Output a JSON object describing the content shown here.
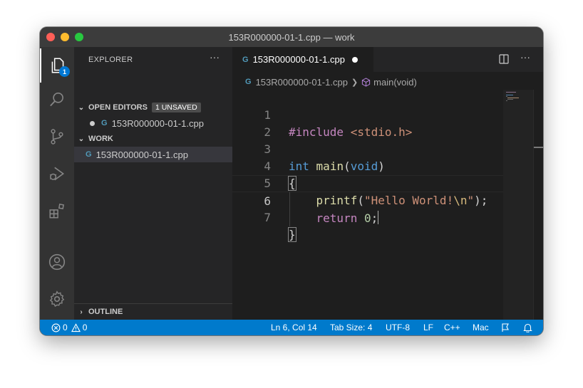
{
  "window": {
    "title": "153R000000-01-1.cpp — work"
  },
  "activity_bar": {
    "explorer_badge": "1"
  },
  "sidebar": {
    "header": "EXPLORER",
    "more": "···",
    "open_editors": {
      "label": "OPEN EDITORS",
      "badge": "1 UNSAVED",
      "file": "153R000000-01-1.cpp"
    },
    "work": {
      "label": "WORK",
      "file": "153R000000-01-1.cpp"
    },
    "outline": {
      "label": "OUTLINE"
    }
  },
  "editor": {
    "tab": {
      "label": "153R000000-01-1.cpp",
      "icon": "G"
    },
    "more": "···",
    "breadcrumb": {
      "file": "153R000000-01-1.cpp",
      "symbol": "main(void)"
    },
    "lines": [
      {
        "n": "1"
      },
      {
        "n": "2"
      },
      {
        "n": "3"
      },
      {
        "n": "4"
      },
      {
        "n": "5"
      },
      {
        "n": "6"
      },
      {
        "n": "7"
      }
    ],
    "code": {
      "l1_pre": "#include",
      "l1_header": "<stdio.h>",
      "l3_type": "int",
      "l3_fn": "main",
      "l3_open": "(",
      "l3_param": "void",
      "l3_close": ")",
      "l4": "{",
      "l5_indent": "    ",
      "l5_fn": "printf",
      "l5_open": "(",
      "l5_str": "\"Hello World!",
      "l5_esc": "\\n",
      "l5_strend": "\"",
      "l5_close": ");",
      "l6_indent": "    ",
      "l6_kw": "return",
      "l6_sp": " ",
      "l6_num": "0",
      "l6_semi": ";",
      "l7": "}"
    }
  },
  "status_bar": {
    "errors": "0",
    "warnings": "0",
    "position": "Ln 6, Col 14",
    "tab_size": "Tab Size: 4",
    "encoding": "UTF-8",
    "eol": "LF",
    "language": "C++",
    "platform": "Mac"
  },
  "colors": {
    "accent": "#007acc",
    "badge": "#0078d4",
    "file_icon": "#519aba"
  }
}
